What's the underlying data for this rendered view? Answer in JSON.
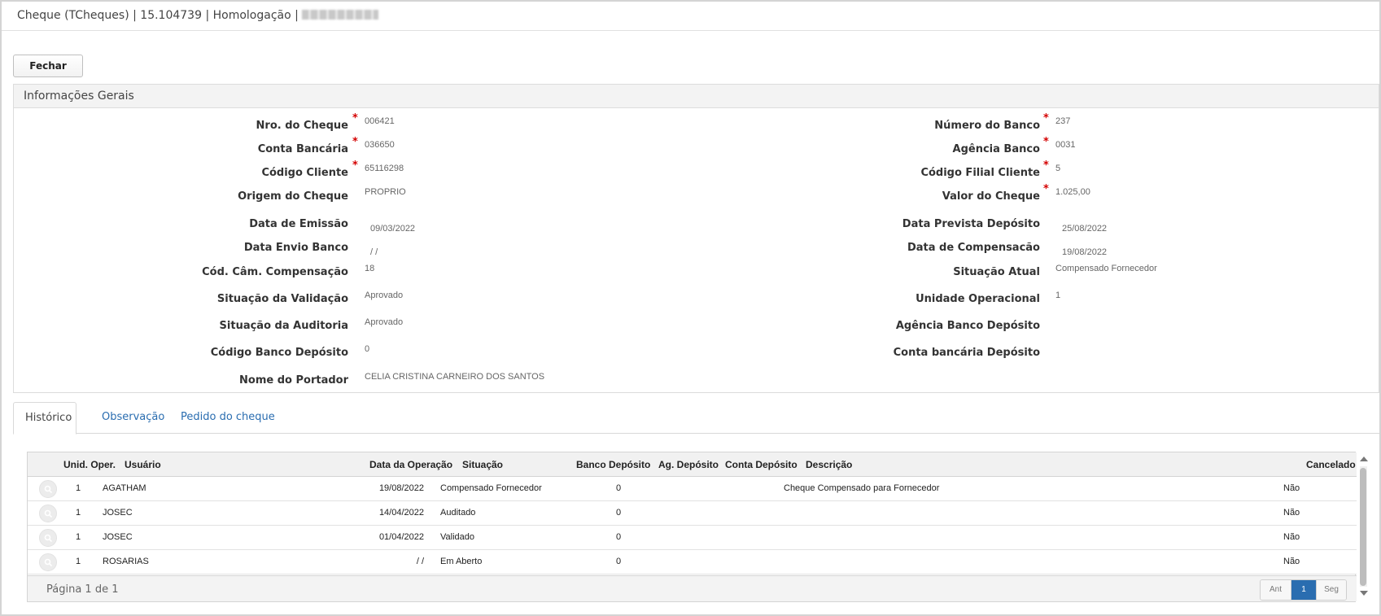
{
  "window": {
    "title": "Cheque (TCheques) | 15.104739 | Homologação | "
  },
  "toolbar": {
    "close_label": "Fechar"
  },
  "section": {
    "title": "Informações Gerais",
    "left": [
      {
        "label": "Nro. do Cheque",
        "value": "006421",
        "required": true
      },
      {
        "label": "Conta Bancária",
        "value": "036650",
        "required": true
      },
      {
        "label": "Código Cliente",
        "value": "65116298",
        "required": true
      },
      {
        "label": "Origem do Cheque",
        "value": "PROPRIO",
        "required": false
      },
      {
        "label": "Data de Emissão",
        "value": "09/03/2022",
        "required": false
      },
      {
        "label": "Data Envio Banco",
        "value": " / /",
        "required": false
      },
      {
        "label": "Cód. Câm. Compensação",
        "value": "18",
        "required": false
      },
      {
        "label": "Situação da Validação",
        "value": "Aprovado",
        "required": false
      },
      {
        "label": "Situação da Auditoria",
        "value": "Aprovado",
        "required": false
      },
      {
        "label": "Código Banco Depósito",
        "value": "0",
        "required": false
      },
      {
        "label": "Nome do Portador",
        "value": "CELIA CRISTINA CARNEIRO DOS SANTOS",
        "required": false
      }
    ],
    "right": [
      {
        "label": "Número do Banco",
        "value": "237",
        "required": true
      },
      {
        "label": "Agência Banco",
        "value": "0031",
        "required": true
      },
      {
        "label": "Código Filial Cliente",
        "value": "5",
        "required": true
      },
      {
        "label": "Valor do Cheque",
        "value": "1.025,00",
        "required": true
      },
      {
        "label": "Data Prevista Depósito",
        "value": "25/08/2022",
        "required": false
      },
      {
        "label": "Data de Compensacão",
        "value": "19/08/2022",
        "required": false
      },
      {
        "label": "Situação Atual",
        "value": "Compensado Fornecedor",
        "required": false
      },
      {
        "label": "Unidade Operacional",
        "value": "1",
        "required": false
      },
      {
        "label": "Agência Banco Depósito",
        "value": "",
        "required": false
      },
      {
        "label": "Conta bancária Depósito",
        "value": "",
        "required": false
      }
    ],
    "required_mark": "*"
  },
  "tabs": [
    {
      "label": "Histórico",
      "active": true
    },
    {
      "label": "Observação",
      "active": false
    },
    {
      "label": "Pedido do cheque",
      "active": false
    }
  ],
  "grid": {
    "columns": [
      "Unid. Oper.",
      "Usuário",
      "Data da Operação",
      "Situação",
      "Banco Depósito",
      "Ag. Depósito",
      "Conta Depósito",
      "Descrição",
      "Cancelado"
    ],
    "rows": [
      {
        "unid": "1",
        "usuario": "AGATHAM",
        "data": "19/08/2022",
        "situacao": "Compensado Fornecedor",
        "banco": "0",
        "agencia": "",
        "conta": "",
        "descricao": "Cheque Compensado para Fornecedor",
        "cancelado": "Não"
      },
      {
        "unid": "1",
        "usuario": "JOSEC",
        "data": "14/04/2022",
        "situacao": "Auditado",
        "banco": "0",
        "agencia": "",
        "conta": "",
        "descricao": "",
        "cancelado": "Não"
      },
      {
        "unid": "1",
        "usuario": "JOSEC",
        "data": "01/04/2022",
        "situacao": "Validado",
        "banco": "0",
        "agencia": "",
        "conta": "",
        "descricao": "",
        "cancelado": "Não"
      },
      {
        "unid": "1",
        "usuario": "ROSARIAS",
        "data": " / /",
        "situacao": "Em Aberto",
        "banco": "0",
        "agencia": "",
        "conta": "",
        "descricao": "",
        "cancelado": "Não"
      }
    ],
    "page_info": "Página 1 de 1",
    "pager": {
      "prev": "Ant",
      "current": "1",
      "next": "Seg"
    },
    "row_icon": "search-icon"
  },
  "colors": {
    "accent": "#2a6db0",
    "required": "#d40000"
  }
}
